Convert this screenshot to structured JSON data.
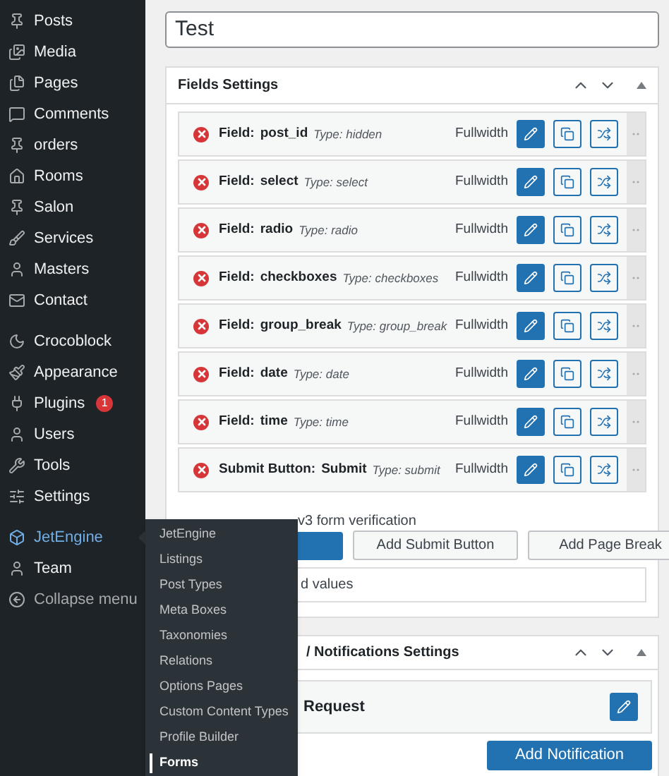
{
  "sidebar": {
    "sections": [
      {
        "items": [
          {
            "label": "Posts",
            "selected": false
          },
          {
            "label": "Media",
            "selected": false
          },
          {
            "label": "Pages",
            "selected": false
          },
          {
            "label": "Comments",
            "selected": false
          },
          {
            "label": "orders",
            "selected": false
          },
          {
            "label": "Rooms",
            "selected": false
          },
          {
            "label": "Salon",
            "selected": false
          },
          {
            "label": "Services",
            "selected": false
          },
          {
            "label": "Masters",
            "selected": false
          },
          {
            "label": "Contact",
            "selected": false
          }
        ]
      },
      {
        "items": [
          {
            "label": "Crocoblock",
            "selected": false
          },
          {
            "label": "Appearance",
            "selected": false
          },
          {
            "label": "Plugins",
            "selected": false,
            "badge": "1"
          },
          {
            "label": "Users",
            "selected": false
          },
          {
            "label": "Tools",
            "selected": false
          },
          {
            "label": "Settings",
            "selected": false
          }
        ]
      },
      {
        "items": [
          {
            "label": "JetEngine",
            "selected": true
          },
          {
            "label": "Team",
            "selected": false
          },
          {
            "label": "Collapse menu",
            "selected": false,
            "kind": "collapse"
          }
        ]
      }
    ]
  },
  "submenu": {
    "items": [
      {
        "label": "JetEngine",
        "selected": false
      },
      {
        "label": "Listings",
        "selected": false
      },
      {
        "label": "Post Types",
        "selected": false
      },
      {
        "label": "Meta Boxes",
        "selected": false
      },
      {
        "label": "Taxonomies",
        "selected": false
      },
      {
        "label": "Relations",
        "selected": false
      },
      {
        "label": "Options Pages",
        "selected": false
      },
      {
        "label": "Custom Content Types",
        "selected": false
      },
      {
        "label": "Profile Builder",
        "selected": false
      },
      {
        "label": "Forms",
        "selected": true
      }
    ]
  },
  "title_field": {
    "value": "Test"
  },
  "fields_panel": {
    "title": "Fields Settings",
    "rows": [
      {
        "prefix": "Field:",
        "name": "post_id",
        "type": "Type: hidden",
        "width": "Fullwidth"
      },
      {
        "prefix": "Field:",
        "name": "select",
        "type": "Type: select",
        "width": "Fullwidth"
      },
      {
        "prefix": "Field:",
        "name": "radio",
        "type": "Type: radio",
        "width": "Fullwidth"
      },
      {
        "prefix": "Field:",
        "name": "checkboxes",
        "type": "Type: checkboxes",
        "width": "Fullwidth"
      },
      {
        "prefix": "Field:",
        "name": "group_break",
        "type": "Type: group_break",
        "width": "Fullwidth"
      },
      {
        "prefix": "Field:",
        "name": "date",
        "type": "Type: date",
        "width": "Fullwidth"
      },
      {
        "prefix": "Field:",
        "name": "time",
        "type": "Type: time",
        "width": "Fullwidth"
      },
      {
        "prefix": "Submit Button:",
        "name": "Submit",
        "type": "Type: submit",
        "width": "Fullwidth"
      }
    ],
    "captcha_text": "v3 form verification",
    "buttons": [
      "Add Submit Button",
      "Add Page Break"
    ],
    "values_text": "d values"
  },
  "notifications_panel": {
    "title": "/ Notifications Settings",
    "item": "Request",
    "add_button": "Add Notification"
  }
}
